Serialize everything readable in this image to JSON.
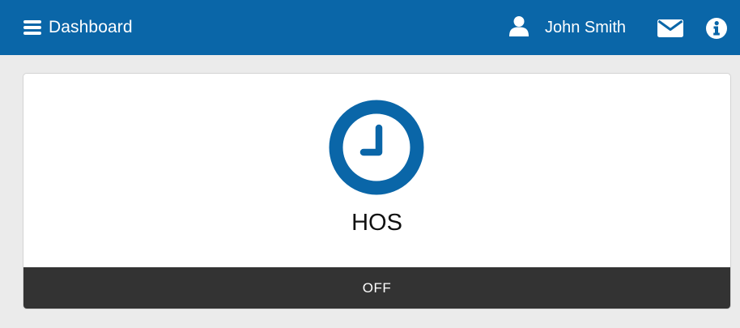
{
  "header": {
    "menu_icon": "hamburger-icon",
    "title": "Dashboard",
    "user_icon": "user-icon",
    "user_name": "John Smith",
    "mail_icon": "envelope-icon",
    "info_icon": "info-icon"
  },
  "card": {
    "icon": "clock-icon",
    "title": "HOS",
    "status": "OFF"
  },
  "colors": {
    "header_bg": "#0a66a8",
    "accent": "#0a66a8",
    "status_bar_bg": "#333333",
    "page_bg": "#ebebeb"
  }
}
